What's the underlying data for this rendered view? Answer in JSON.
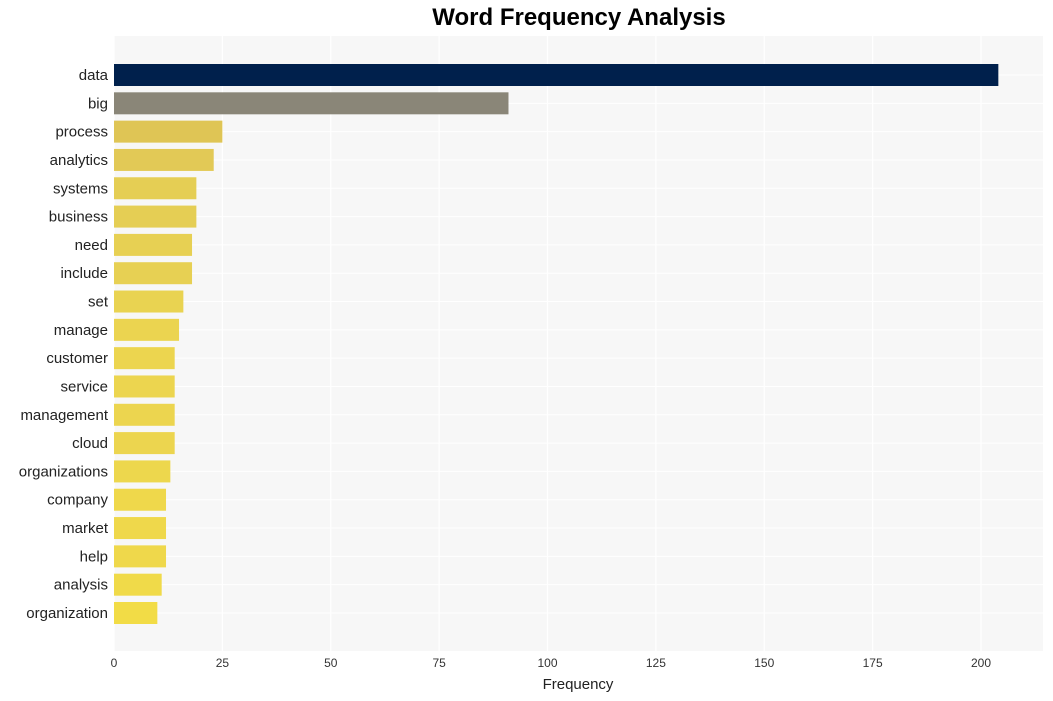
{
  "chart_data": {
    "type": "bar",
    "orientation": "horizontal",
    "title": "Word Frequency Analysis",
    "xlabel": "Frequency",
    "ylabel": "",
    "xlim": [
      0,
      215
    ],
    "xticks": [
      0,
      25,
      50,
      75,
      100,
      125,
      150,
      175,
      200
    ],
    "grid": true,
    "legend": "none",
    "categories": [
      "data",
      "big",
      "process",
      "analytics",
      "systems",
      "business",
      "need",
      "include",
      "set",
      "manage",
      "customer",
      "service",
      "management",
      "cloud",
      "organizations",
      "company",
      "market",
      "help",
      "analysis",
      "organization"
    ],
    "values": [
      204,
      91,
      25,
      23,
      19,
      19,
      18,
      18,
      16,
      15,
      14,
      14,
      14,
      14,
      13,
      12,
      12,
      12,
      11,
      10
    ],
    "colors": [
      "#00204c",
      "#8a8678",
      "#dfc555",
      "#e2c956",
      "#e5ce54",
      "#e5ce54",
      "#e7d053",
      "#e7d053",
      "#e9d351",
      "#ebd450",
      "#ecd54f",
      "#ecd54f",
      "#ecd54f",
      "#ecd54f",
      "#edd74d",
      "#efd84b",
      "#efd84b",
      "#efd84b",
      "#f0da49",
      "#f2dc46"
    ]
  }
}
